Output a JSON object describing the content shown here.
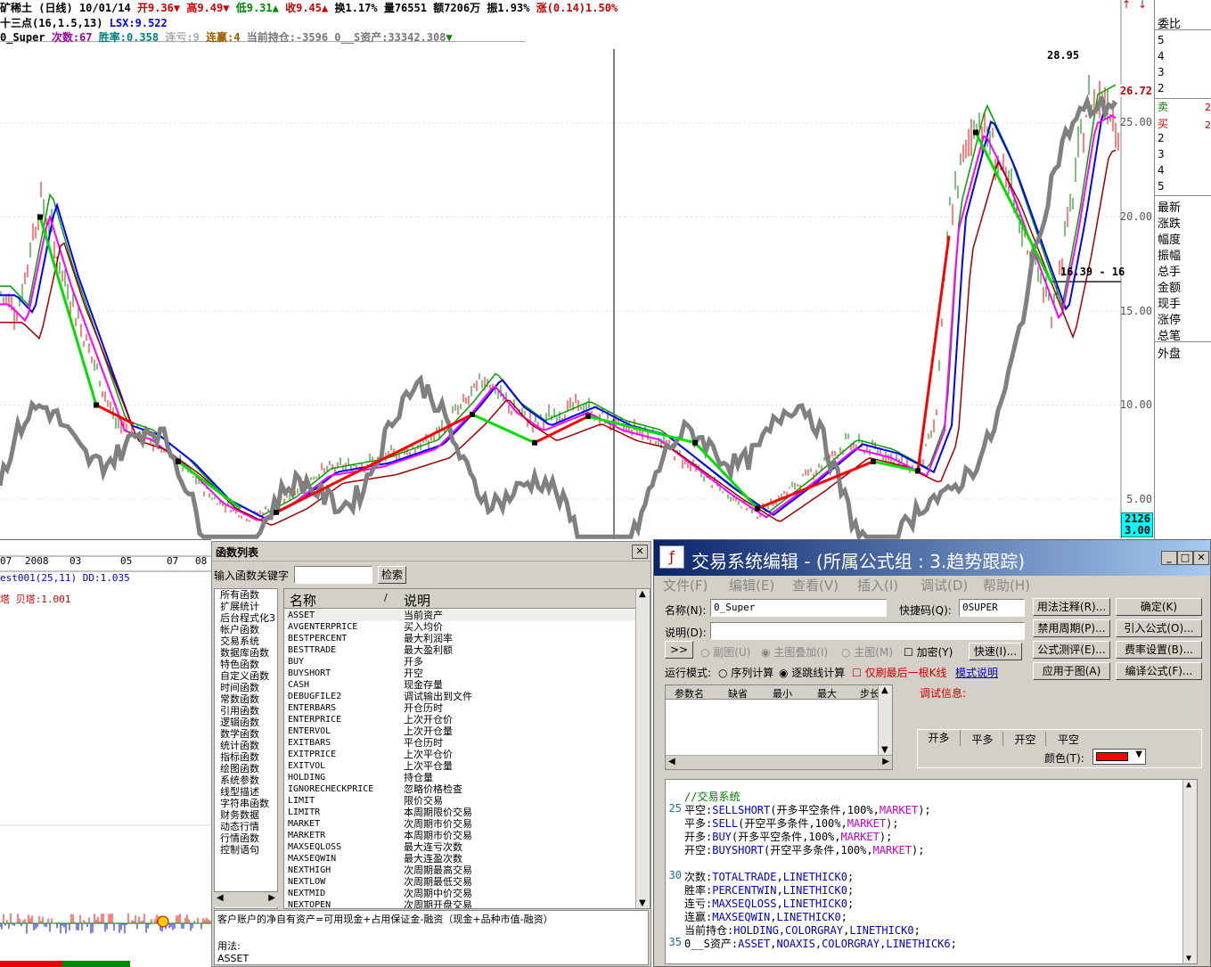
{
  "header": {
    "stock_name": "矿稀土",
    "period": "(日线)",
    "date": "10/01/14",
    "open": "开9.36",
    "high": "高9.49",
    "low": "低9.31",
    "close": "收9.45",
    "turnover": "换1.17%",
    "volume": "量76551",
    "amount": "额7206万",
    "amplitude": "振1.93%",
    "change": "涨(0.14)1.50%",
    "indicator_line": "十三点(16,1.5,13)",
    "lsx": "LSX:9.522",
    "system_name": "0_Super",
    "trades": "次数:67",
    "win_rate": "胜率:0.358",
    "loss_streak": "连亏:9",
    "win_streak": "连赢:4",
    "holding": "当前持仓:-3596",
    "assets": "0__S资产:33342.308"
  },
  "price_axis": [
    "25.00",
    "20.00",
    "15.00",
    "10.00",
    "5.00"
  ],
  "price_markers": {
    "peak": "28.95",
    "current": "26.72",
    "range_line": "16.39 - 16",
    "box_top": "2126",
    "box_bottom": "3.00"
  },
  "chart_annotations": {
    "peak_label": "28.95"
  },
  "time_axis": [
    "07",
    "2008",
    "03",
    "05",
    "07",
    "08"
  ],
  "lower_indicator": {
    "line1": "est001(25,11) DD:1.035",
    "line2": "塔 贝塔:1.001"
  },
  "side_panel": {
    "title": "委比",
    "rows": [
      "5",
      "4",
      "3",
      "2",
      "卖",
      "买",
      "2",
      "3",
      "4",
      "5",
      "最新",
      "涨跌",
      "幅度",
      "振幅",
      "总手",
      "金额",
      "现手",
      "涨停",
      "总笔",
      "外盘"
    ],
    "side_vals": [
      "2",
      "2"
    ]
  },
  "func_dialog": {
    "title": "函数列表",
    "search_label": "输入函数关键字",
    "search_button": "检索",
    "categories": [
      "所有函数",
      "扩展统计",
      "后台程式化3",
      "帐户函数",
      "交易系统",
      "数据库函数",
      "特色函数",
      "自定义函数",
      "时间函数",
      "常数函数",
      "引用函数",
      "逻辑函数",
      "数学函数",
      "统计函数",
      "指标函数",
      "绘图函数",
      "系统参数",
      "线型描述",
      "字符串函数",
      "财务数据",
      "动态行情",
      "行情函数",
      "控制语句"
    ],
    "col_name": "名称",
    "col_desc": "说明",
    "functions": [
      {
        "name": "ASSET",
        "desc": "当前资产"
      },
      {
        "name": "AVGENTERPRICE",
        "desc": "买入均价"
      },
      {
        "name": "BESTPERCENT",
        "desc": "最大利润率"
      },
      {
        "name": "BESTTRADE",
        "desc": "最大盈利额"
      },
      {
        "name": "BUY",
        "desc": "开多"
      },
      {
        "name": "BUYSHORT",
        "desc": "开空"
      },
      {
        "name": "CASH",
        "desc": "现金存量"
      },
      {
        "name": "DEBUGFILE2",
        "desc": "调试输出到文件"
      },
      {
        "name": "ENTERBARS",
        "desc": "开仓历时"
      },
      {
        "name": "ENTERPRICE",
        "desc": "上次开仓价"
      },
      {
        "name": "ENTERVOL",
        "desc": "上次开仓量"
      },
      {
        "name": "EXITBARS",
        "desc": "平仓历时"
      },
      {
        "name": "EXITPRICE",
        "desc": "上次平仓价"
      },
      {
        "name": "EXITVOL",
        "desc": "上次平仓量"
      },
      {
        "name": "HOLDING",
        "desc": "持仓量"
      },
      {
        "name": "IGNORECHECKPRICE",
        "desc": "忽略价格检查"
      },
      {
        "name": "LIMIT",
        "desc": "限价交易"
      },
      {
        "name": "LIMITR",
        "desc": "本周期限价交易"
      },
      {
        "name": "MARKET",
        "desc": "次周期市价交易"
      },
      {
        "name": "MARKETR",
        "desc": "本周期市价交易"
      },
      {
        "name": "MAXSEQLOSS",
        "desc": "最大连亏次数"
      },
      {
        "name": "MAXSEQWIN",
        "desc": "最大连盈次数"
      },
      {
        "name": "NEXTHIGH",
        "desc": "次周期最高交易"
      },
      {
        "name": "NEXTLOW",
        "desc": "次周期最低交易"
      },
      {
        "name": "NEXTMID",
        "desc": "次周期中价交易"
      },
      {
        "name": "NEXTOPEN",
        "desc": "次周期开盘交易"
      }
    ],
    "help_text": "客户账户的净自有资产=可用现金+占用保证金-融资（现金+品种市值-融资）",
    "usage_label": "用法:",
    "usage_value": "ASSET"
  },
  "editor": {
    "title": "交易系统编辑 - (所属公式组 : 3.趋势跟踪)",
    "menu": [
      "文件(F)",
      "编辑(E)",
      "查看(V)",
      "插入(I)",
      "调试(D)",
      "帮助(H)"
    ],
    "name_label": "名称(N):",
    "name_value": "0_Super",
    "code_label": "快捷码(Q):",
    "code_value": "0SUPER",
    "desc_label": "说明(D):",
    "desc_value": "",
    "btn_annotate": "用法注释(R)...",
    "btn_ok": "确定(K)",
    "btn_disable": "禁用周期(P)...",
    "btn_import": "引入公式(O)...",
    "btn_test": "公式测评(E)...",
    "btn_fee": "费率设置(B)...",
    "btn_apply": "应用于图(A)",
    "btn_compile": "编译公式(F)...",
    "btn_expand": ">>",
    "opt_sub": "副图(U)",
    "opt_main_overlay": "主图叠加(I)",
    "opt_main": "主图(M)",
    "chk_encrypt": "加密(Y)",
    "btn_quick": "快速(I)...",
    "run_mode_label": "运行模式:",
    "opt_seq": "序列计算",
    "opt_bar": "逐跳线计算",
    "chk_last": "仅刷最后一根K线",
    "mode_help": "模式说明",
    "param_headers": [
      "参数名",
      "缺省",
      "最小",
      "最大",
      "步长"
    ],
    "debug_label": "调试信息:",
    "tabs": [
      "开多",
      "平多",
      "开空",
      "平空"
    ],
    "color_label": "颜色(T):",
    "color_value": "#ff0000",
    "code_lines": [
      {
        "ln": "",
        "text": "//交易系统"
      },
      {
        "ln": "25",
        "text": "平空:SELLSHORT(开多平空条件,100%,MARKET);"
      },
      {
        "ln": "",
        "text": "平多:SELL(开空平多条件,100%,MARKET);"
      },
      {
        "ln": "",
        "text": "开多:BUY(开多平空条件,100%,MARKET);"
      },
      {
        "ln": "",
        "text": "开空:BUYSHORT(开空平多条件,100%,MARKET);"
      },
      {
        "ln": "",
        "text": ""
      },
      {
        "ln": "30",
        "text": "次数:TOTALTRADE,LINETHICK0;"
      },
      {
        "ln": "",
        "text": "胜率:PERCENTWIN,LINETHICK0;"
      },
      {
        "ln": "",
        "text": "连亏:MAXSEQLOSS,LINETHICK0;"
      },
      {
        "ln": "",
        "text": "连赢:MAXSEQWIN,LINETHICK0;"
      },
      {
        "ln": "",
        "text": "当前持仓:HOLDING,COLORGRAY,LINETHICK0;"
      },
      {
        "ln": "35",
        "text": "0__S资产:ASSET,NOAXIS,COLORGRAY,LINETHICK6;"
      }
    ]
  },
  "colors": {
    "up": "#ff0000",
    "down": "#008000",
    "asset_line": "#808080",
    "buy_line": "#00e000",
    "sell_line": "#ff0000",
    "ma_blue": "#0000ff",
    "ma_magenta": "#ff00ff",
    "ma_green": "#00a000"
  }
}
